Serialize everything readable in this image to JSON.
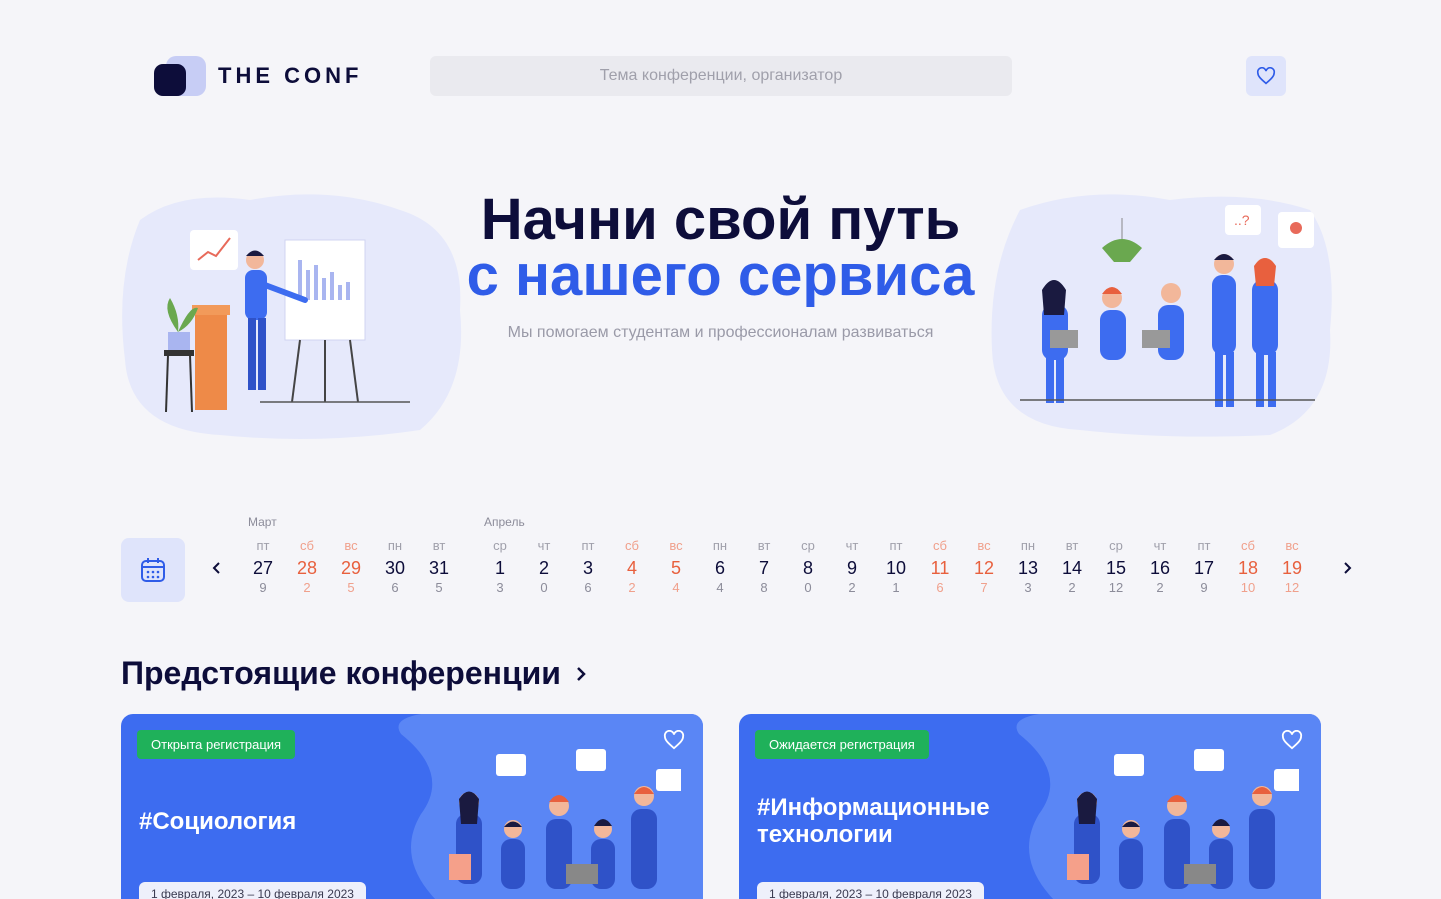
{
  "header": {
    "logo_text": "THE CONF",
    "search_placeholder": "Тема конференции, организатор"
  },
  "hero": {
    "title_line1": "Начни свой путь",
    "title_line2": "с нашего сервиса",
    "subtitle": "Мы помогаем студентам и профессионалам развиваться"
  },
  "calendar": {
    "months": [
      "Март",
      "Апрель"
    ],
    "days": [
      {
        "dow": "пт",
        "num": "27",
        "count": "9",
        "weekend": false
      },
      {
        "dow": "сб",
        "num": "28",
        "count": "2",
        "weekend": true
      },
      {
        "dow": "вс",
        "num": "29",
        "count": "5",
        "weekend": true
      },
      {
        "dow": "пн",
        "num": "30",
        "count": "6",
        "weekend": false
      },
      {
        "dow": "вт",
        "num": "31",
        "count": "5",
        "weekend": false
      },
      {
        "dow": "ср",
        "num": "1",
        "count": "3",
        "weekend": false
      },
      {
        "dow": "чт",
        "num": "2",
        "count": "0",
        "weekend": false
      },
      {
        "dow": "пт",
        "num": "3",
        "count": "6",
        "weekend": false
      },
      {
        "dow": "сб",
        "num": "4",
        "count": "2",
        "weekend": true
      },
      {
        "dow": "вс",
        "num": "5",
        "count": "4",
        "weekend": true
      },
      {
        "dow": "пн",
        "num": "6",
        "count": "4",
        "weekend": false
      },
      {
        "dow": "вт",
        "num": "7",
        "count": "8",
        "weekend": false
      },
      {
        "dow": "ср",
        "num": "8",
        "count": "0",
        "weekend": false
      },
      {
        "dow": "чт",
        "num": "9",
        "count": "2",
        "weekend": false
      },
      {
        "dow": "пт",
        "num": "10",
        "count": "1",
        "weekend": false
      },
      {
        "dow": "сб",
        "num": "11",
        "count": "6",
        "weekend": true
      },
      {
        "dow": "вс",
        "num": "12",
        "count": "7",
        "weekend": true
      },
      {
        "dow": "пн",
        "num": "13",
        "count": "3",
        "weekend": false
      },
      {
        "dow": "вт",
        "num": "14",
        "count": "2",
        "weekend": false
      },
      {
        "dow": "ср",
        "num": "15",
        "count": "12",
        "weekend": false
      },
      {
        "dow": "чт",
        "num": "16",
        "count": "2",
        "weekend": false
      },
      {
        "dow": "пт",
        "num": "17",
        "count": "9",
        "weekend": false
      },
      {
        "dow": "сб",
        "num": "18",
        "count": "10",
        "weekend": true
      },
      {
        "dow": "вс",
        "num": "19",
        "count": "12",
        "weekend": true
      }
    ]
  },
  "upcoming": {
    "title": "Предстоящие конференции",
    "cards": [
      {
        "badge": "Открыта регистрация",
        "title": "#Социология",
        "date": "1 февраля, 2023 – 10 февраля 2023"
      },
      {
        "badge": "Ожидается регистрация",
        "title": "#Информационные технологии",
        "date": "1 февраля, 2023 – 10 февраля 2023"
      }
    ]
  },
  "colors": {
    "brand_blue": "#2f5ce8",
    "dark_navy": "#0d0d3a",
    "weekend": "#e8603e",
    "badge_green": "#1fb15a",
    "card_blue": "#3d6cf0"
  },
  "icons": [
    "heart-icon",
    "calendar-icon",
    "chevron-left-icon",
    "chevron-right-icon"
  ]
}
